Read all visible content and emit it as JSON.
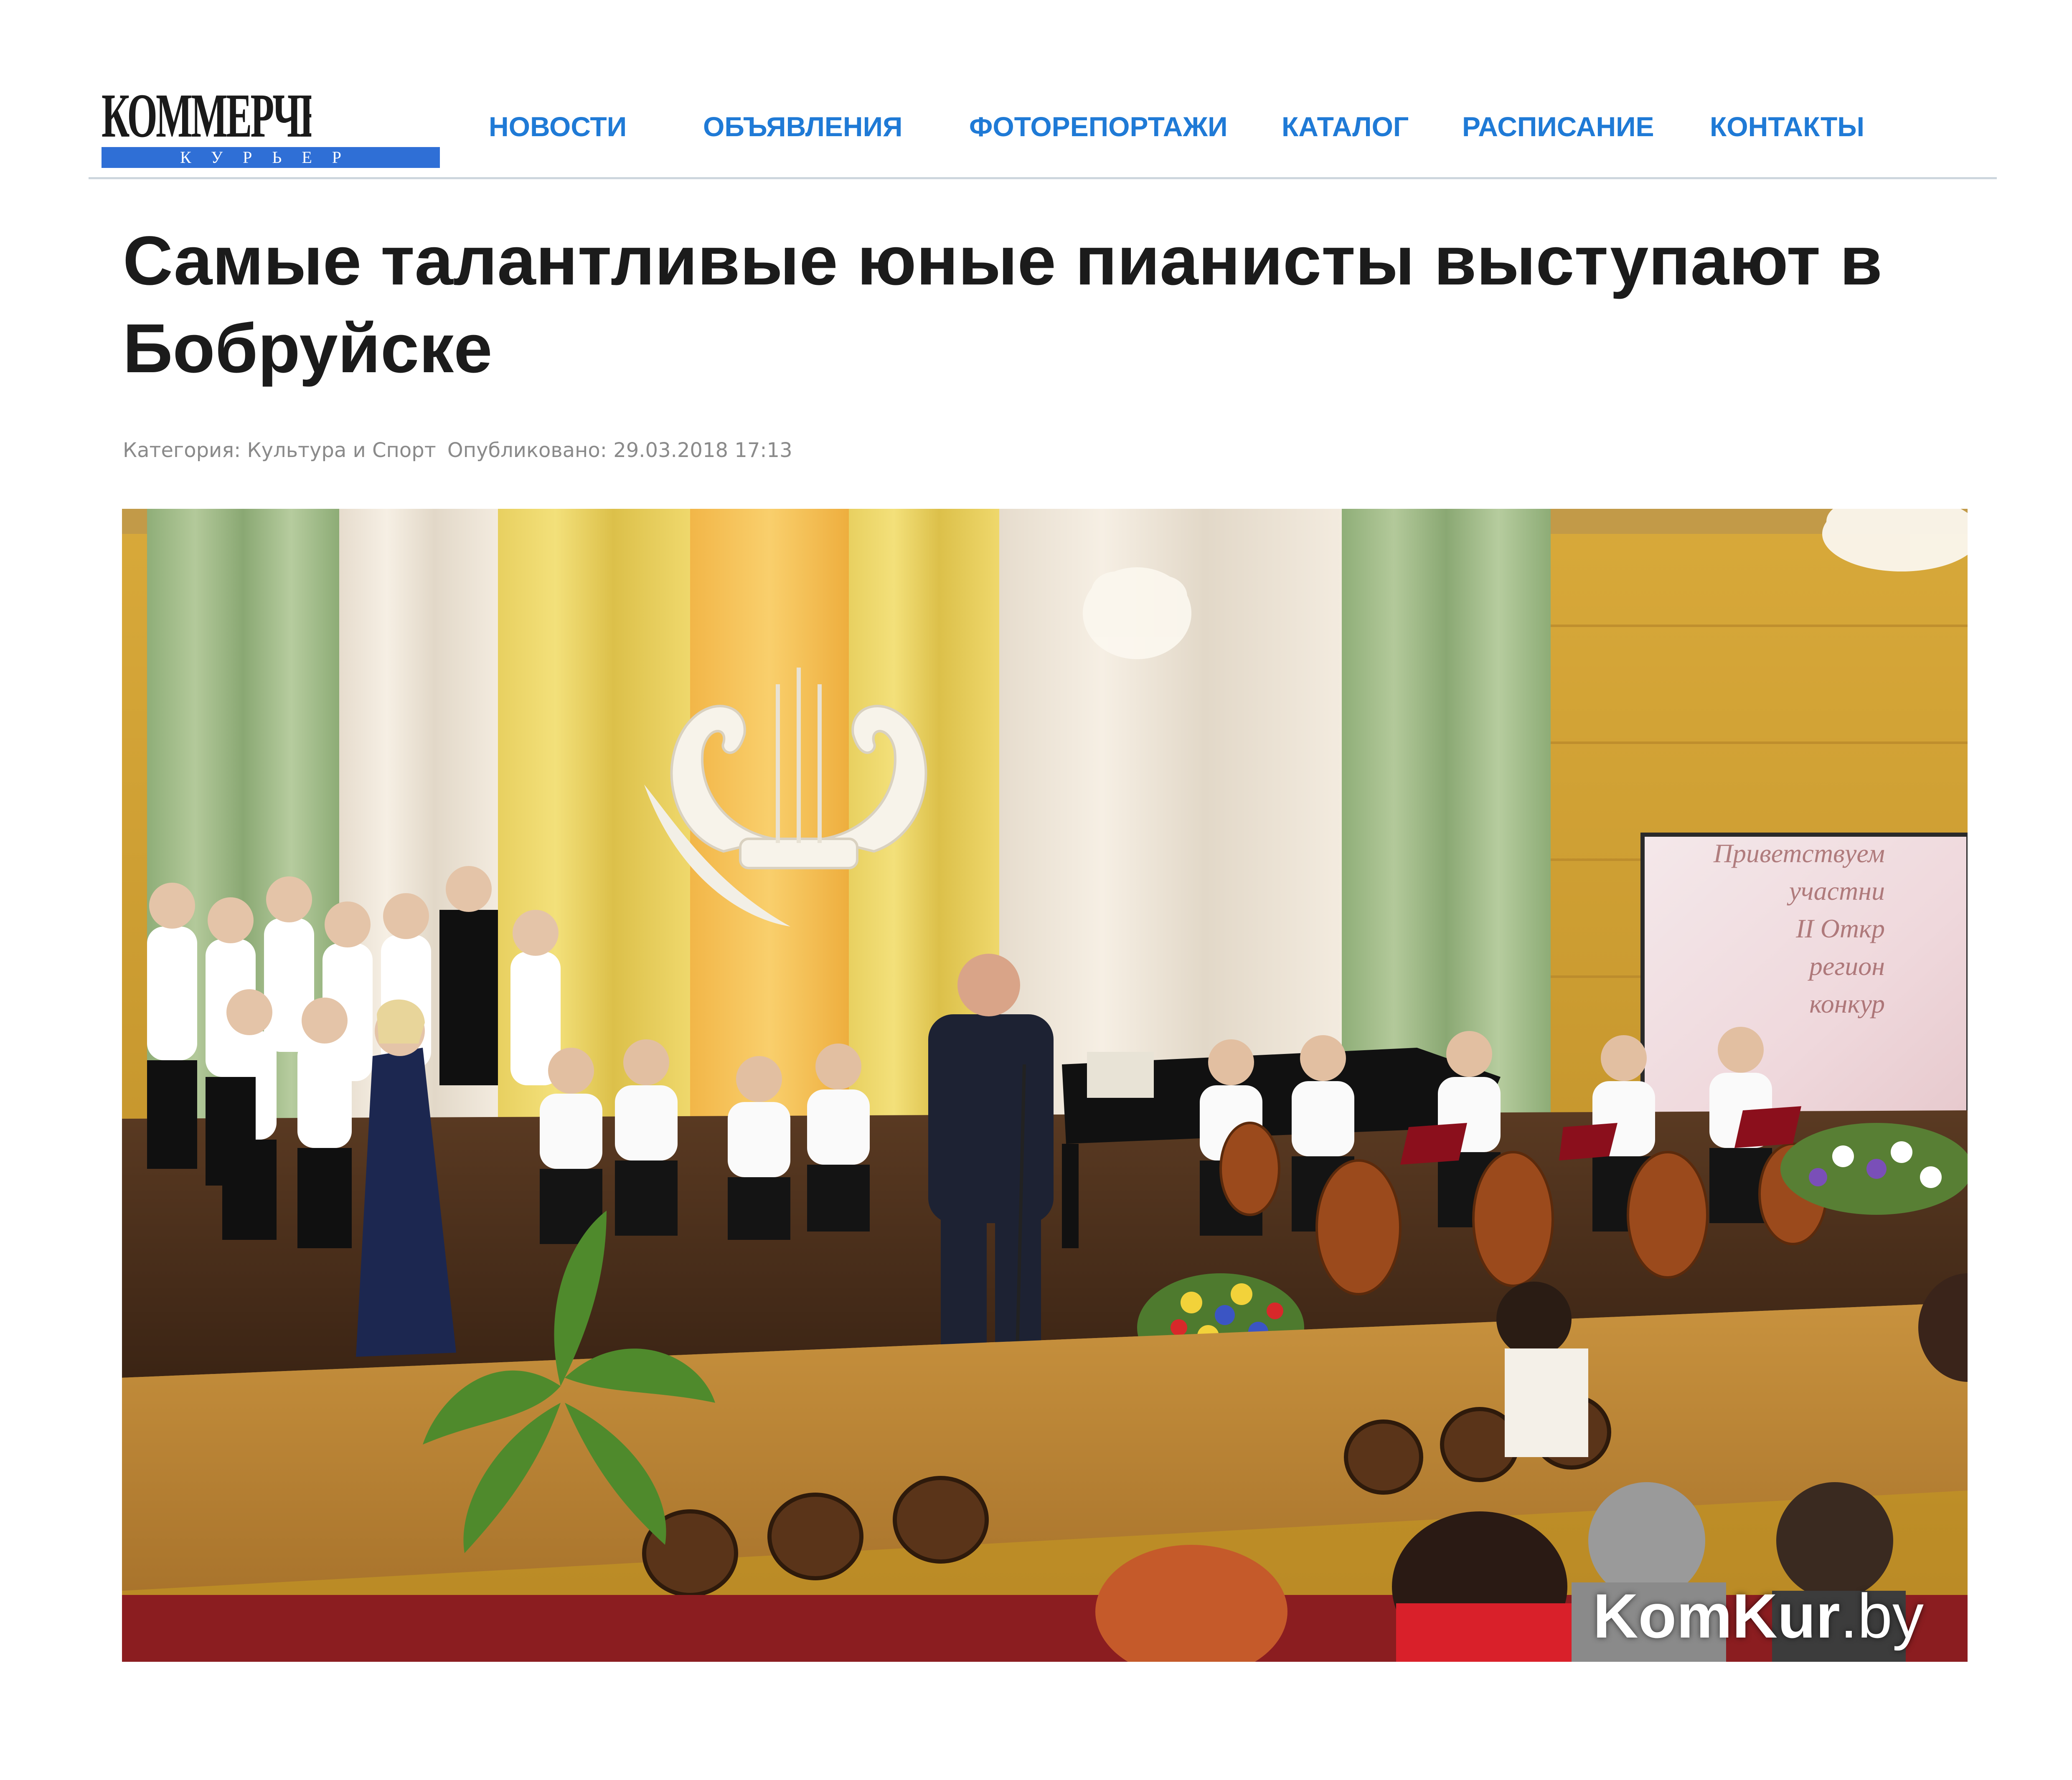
{
  "site": {
    "logo_word": "КОММЕРЧЕСКИЙ",
    "logo_sub": "КУРЬЕР",
    "brand_blue": "#2f6fd6",
    "link_blue": "#1f7ad6"
  },
  "nav": {
    "items": [
      {
        "label": "НОВОСТИ"
      },
      {
        "label": "ОБЪЯВЛЕНИЯ"
      },
      {
        "label": "ФОТОРЕПОРТАЖИ"
      },
      {
        "label": "КАТАЛОГ"
      },
      {
        "label": "РАСПИСАНИЕ"
      },
      {
        "label": "КОНТАКТЫ"
      }
    ]
  },
  "article": {
    "title": "Самые талантливые юные пианисты выступают в Бобруйске",
    "category_label": "Категория: Культура и Спорт",
    "published_label": "Опубликовано: 29.03.2018 17:13",
    "photo": {
      "alt_name": "concert-photo",
      "watermark_bold": "KomKur",
      "watermark_rest": ".by",
      "screen_text": "Приветствуем\nучастни\nII Откр\nрегион\nконкур"
    }
  }
}
